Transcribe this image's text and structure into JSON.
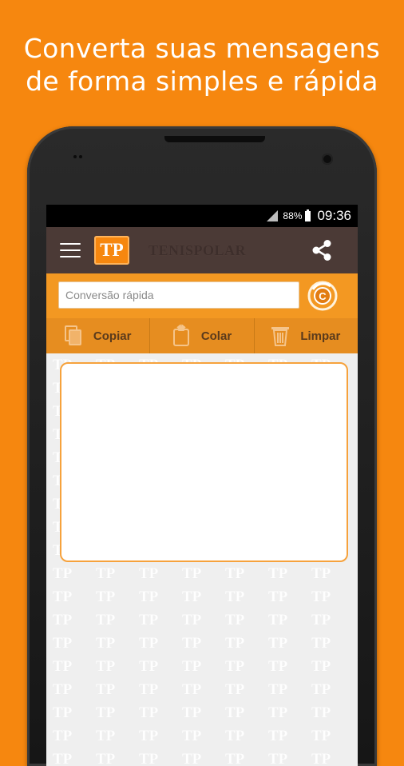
{
  "headline": {
    "line1": "Converta suas mensagens",
    "line2": "de forma simples e rápida"
  },
  "status_bar": {
    "battery": "88%",
    "time": "09:36"
  },
  "app_bar": {
    "logo_text": "TP",
    "brand": "TENISPOLAR",
    "icons": [
      "menu-icon",
      "share-icon"
    ]
  },
  "search": {
    "placeholder": "Conversão rápida",
    "value": "",
    "convert_icon": "convert-icon"
  },
  "toolbar": {
    "copy_label": "Copiar",
    "paste_label": "Colar",
    "clear_label": "Limpar"
  },
  "editor": {
    "value": ""
  },
  "watermark_text": "TP",
  "colors": {
    "background": "#f6870f",
    "app_bar": "#4b3a36",
    "search_row": "#f39822",
    "toolbar": "#e68d20"
  }
}
